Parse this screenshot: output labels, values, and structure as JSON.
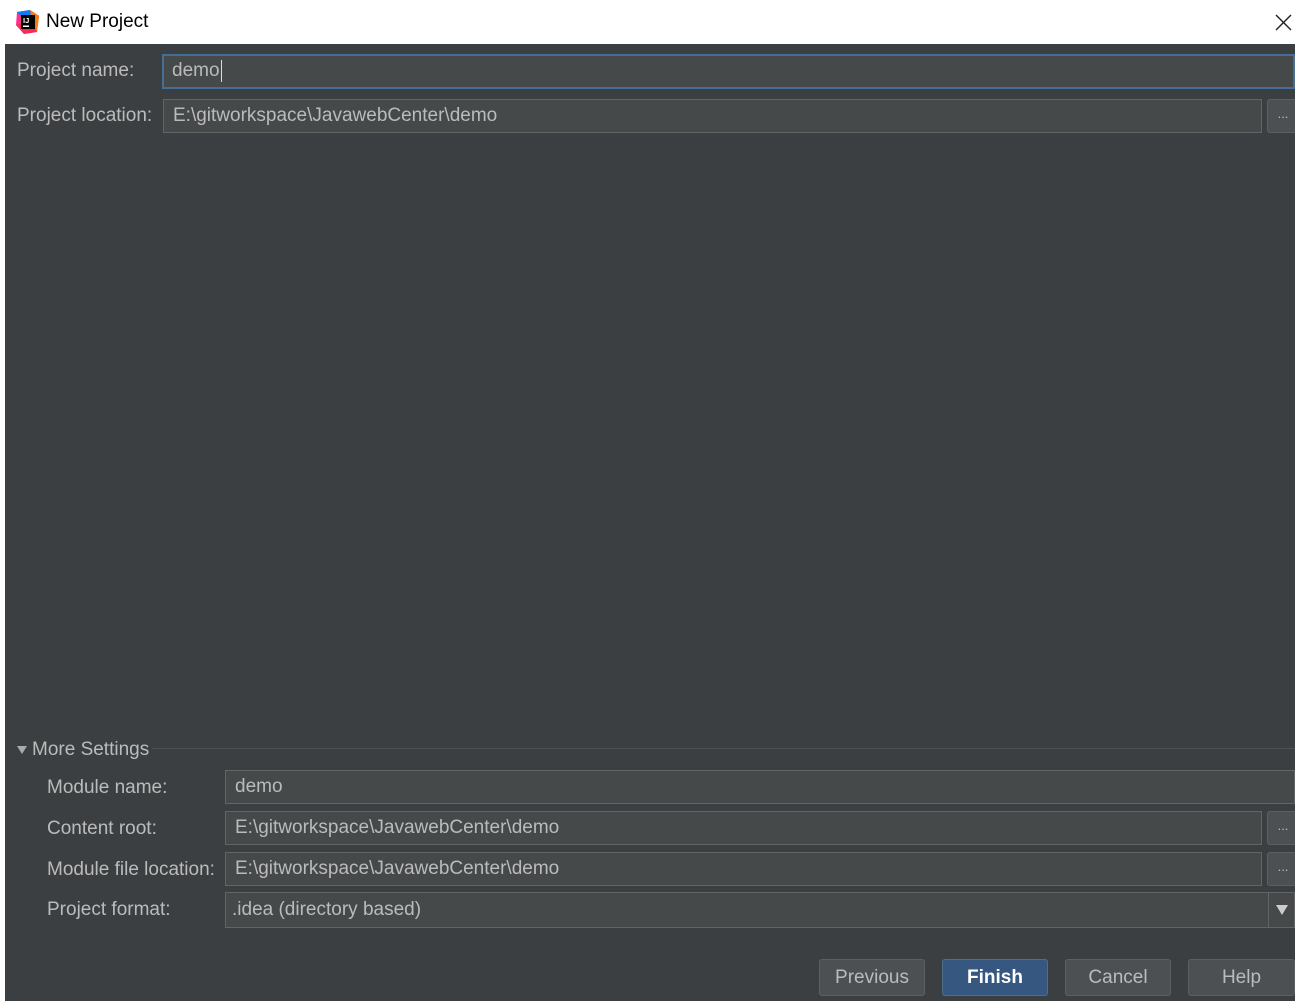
{
  "window": {
    "title": "New Project",
    "app_icon": "intellij-idea-icon"
  },
  "form": {
    "project_name": {
      "label": "Project name:",
      "value": "demo"
    },
    "project_location": {
      "label": "Project location:",
      "value": "E:\\gitworkspace\\JavawebCenter\\demo",
      "browse_label": "..."
    }
  },
  "more_settings": {
    "header": "More Settings",
    "expanded": true,
    "module_name": {
      "label": "Module name:",
      "value": "demo"
    },
    "content_root": {
      "label": "Content root:",
      "value": "E:\\gitworkspace\\JavawebCenter\\demo",
      "browse_label": "..."
    },
    "module_file_location": {
      "label": "Module file location:",
      "value": "E:\\gitworkspace\\JavawebCenter\\demo",
      "browse_label": "..."
    },
    "project_format": {
      "label": "Project format:",
      "value": ".idea (directory based)"
    }
  },
  "buttons": {
    "previous": "Previous",
    "finish": "Finish",
    "cancel": "Cancel",
    "help": "Help"
  },
  "colors": {
    "background": "#3c3f41",
    "field_background": "#45494a",
    "focus_border": "#466d94",
    "primary_button": "#365880",
    "text": "#bbbbbb"
  }
}
